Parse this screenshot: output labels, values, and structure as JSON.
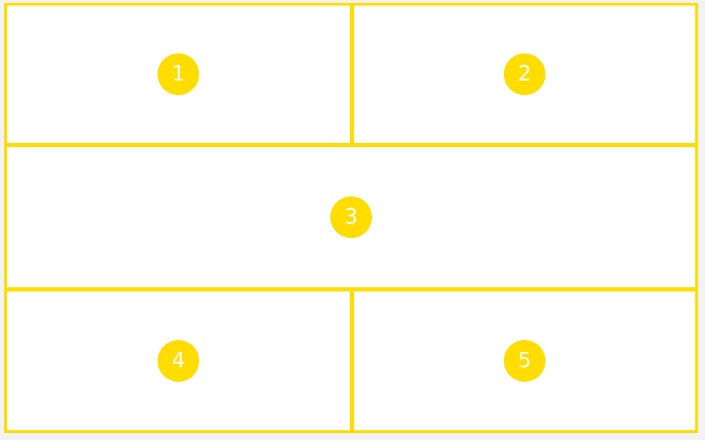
{
  "theme": {
    "accent": "#ffdd00",
    "cell_background": "#ffffff",
    "page_background": "#f2f2f2",
    "badge_text_color": "#ffffff"
  },
  "cells": [
    {
      "label": "1"
    },
    {
      "label": "2"
    },
    {
      "label": "3"
    },
    {
      "label": "4"
    },
    {
      "label": "5"
    }
  ]
}
